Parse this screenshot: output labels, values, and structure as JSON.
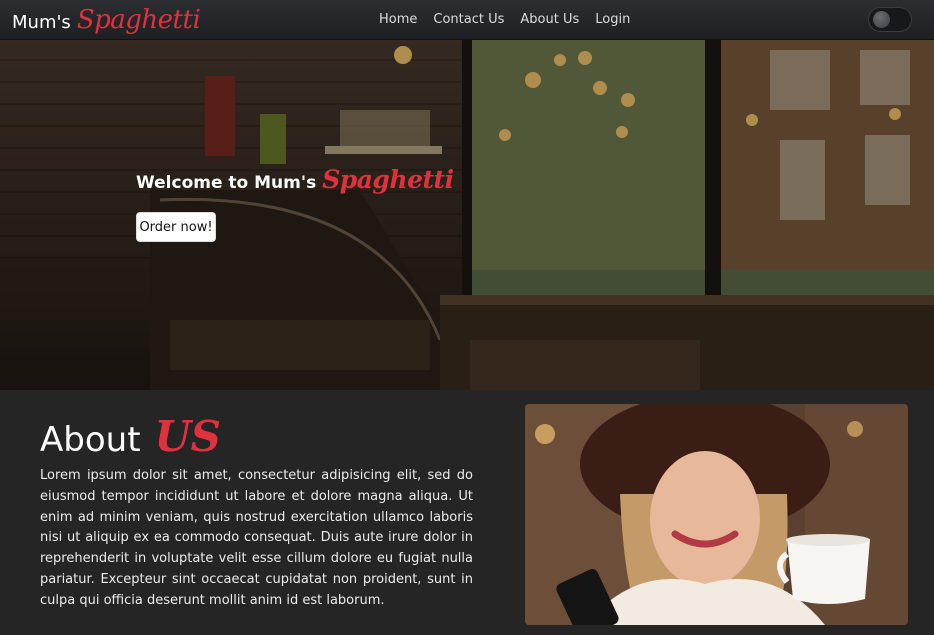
{
  "nav": {
    "brand_main": "Mum's",
    "brand_accent": "Spaghetti",
    "links": [
      "Home",
      "Contact Us",
      "About Us",
      "Login"
    ]
  },
  "hero": {
    "title": "Welcome to Mum's",
    "title_accent": "Spaghetti",
    "button_label": "Order now!"
  },
  "about": {
    "heading": "About",
    "heading_accent": "US",
    "paragraph": "Lorem ipsum dolor sit amet, consectetur adipisicing elit, sed do eiusmod tempor incididunt ut labore et dolore magna aliqua. Ut enim ad minim veniam, quis nostrud exercitation ullamco laboris nisi ut aliquip ex ea commodo consequat. Duis aute irure dolor in reprehenderit in voluptate velit esse cillum dolore eu fugiat nulla pariatur. Excepteur sint occaecat cupidatat non proident, sunt in culpa qui officia deserunt mollit anim id est laborum."
  },
  "colors": {
    "accent": "#e0323e",
    "navbar": "#222427",
    "page_background": "#252525"
  },
  "icons": [
    "theme-toggle-icon"
  ]
}
